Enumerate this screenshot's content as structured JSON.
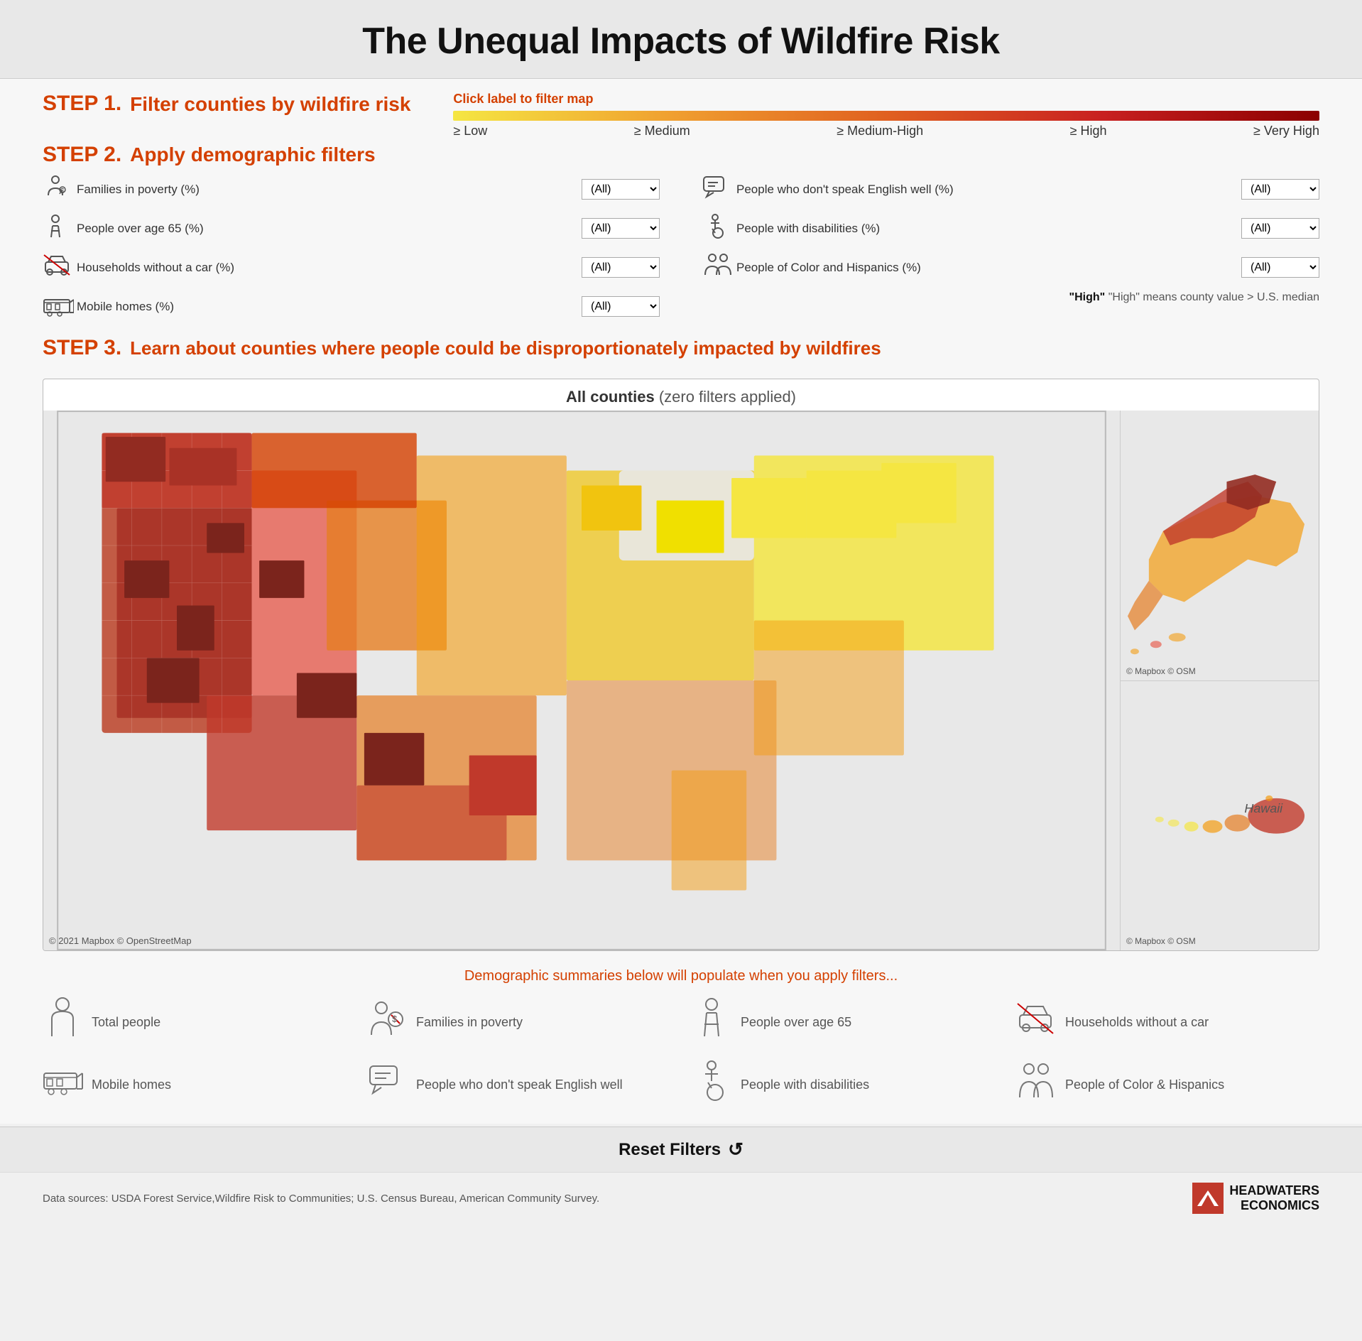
{
  "header": {
    "title": "The Unequal Impacts of Wildfire Risk"
  },
  "step1": {
    "label": "STEP 1.",
    "title": "Filter counties by wildfire risk",
    "click_instruction": "Click label to filter map",
    "risk_levels": [
      "≥ Low",
      "≥ Medium",
      "≥ Medium-High",
      "≥ High",
      "≥ Very High"
    ]
  },
  "step2": {
    "label": "STEP 2.",
    "title": "Apply demographic filters",
    "filters_left": [
      {
        "icon": "poverty-icon",
        "label": "Families in poverty (%)",
        "value": "(All)"
      },
      {
        "icon": "elder-icon",
        "label": "People over age 65 (%)",
        "value": "(All)"
      },
      {
        "icon": "car-icon",
        "label": "Households without a car (%)",
        "value": "(All)"
      },
      {
        "icon": "home-icon",
        "label": "Mobile homes (%)",
        "value": "(All)"
      }
    ],
    "filters_right": [
      {
        "icon": "speech-icon",
        "label": "People who don't speak English well (%)",
        "value": "(All)"
      },
      {
        "icon": "disability-icon",
        "label": "People with disabilities (%)",
        "value": "(All)"
      },
      {
        "icon": "people-icon",
        "label": "People of Color and Hispanics (%)",
        "value": "(All)"
      }
    ],
    "high_note": "\"High\" means county value > U.S. median"
  },
  "step3": {
    "label": "STEP 3.",
    "title": "Learn about counties where people could be disproportionately impacted by wildfires"
  },
  "map": {
    "title": "All counties",
    "subtitle": "(zero filters applied)",
    "credit_main": "© 2021 Mapbox  © OpenStreetMap",
    "credit_alaska": "© Mapbox  © OSM",
    "credit_hawaii": "© Mapbox  © OSM",
    "hawaii_label": "Hawaii"
  },
  "demographics": {
    "message": "Demographic summaries below will populate when you apply filters...",
    "items": [
      {
        "icon": "person-icon",
        "label": "Total people"
      },
      {
        "icon": "poverty-icon",
        "label": "Families in poverty"
      },
      {
        "icon": "elder-icon",
        "label": "People over age 65"
      },
      {
        "icon": "car-icon",
        "label": "Households without a car"
      },
      {
        "icon": "home-icon",
        "label": "Mobile homes"
      },
      {
        "icon": "speech-icon",
        "label": "People who don't speak English well"
      },
      {
        "icon": "disability-icon",
        "label": "People with disabilities"
      },
      {
        "icon": "people-icon",
        "label": "People of Color & Hispanics"
      }
    ]
  },
  "reset": {
    "label": "Reset Filters"
  },
  "footer": {
    "data_sources": "Data sources: USDA Forest Service,Wildfire Risk to Communities; U.S. Census Bureau, American Community Survey.",
    "logo_line1": "HEADWATERS",
    "logo_line2": "ECONOMICS"
  }
}
